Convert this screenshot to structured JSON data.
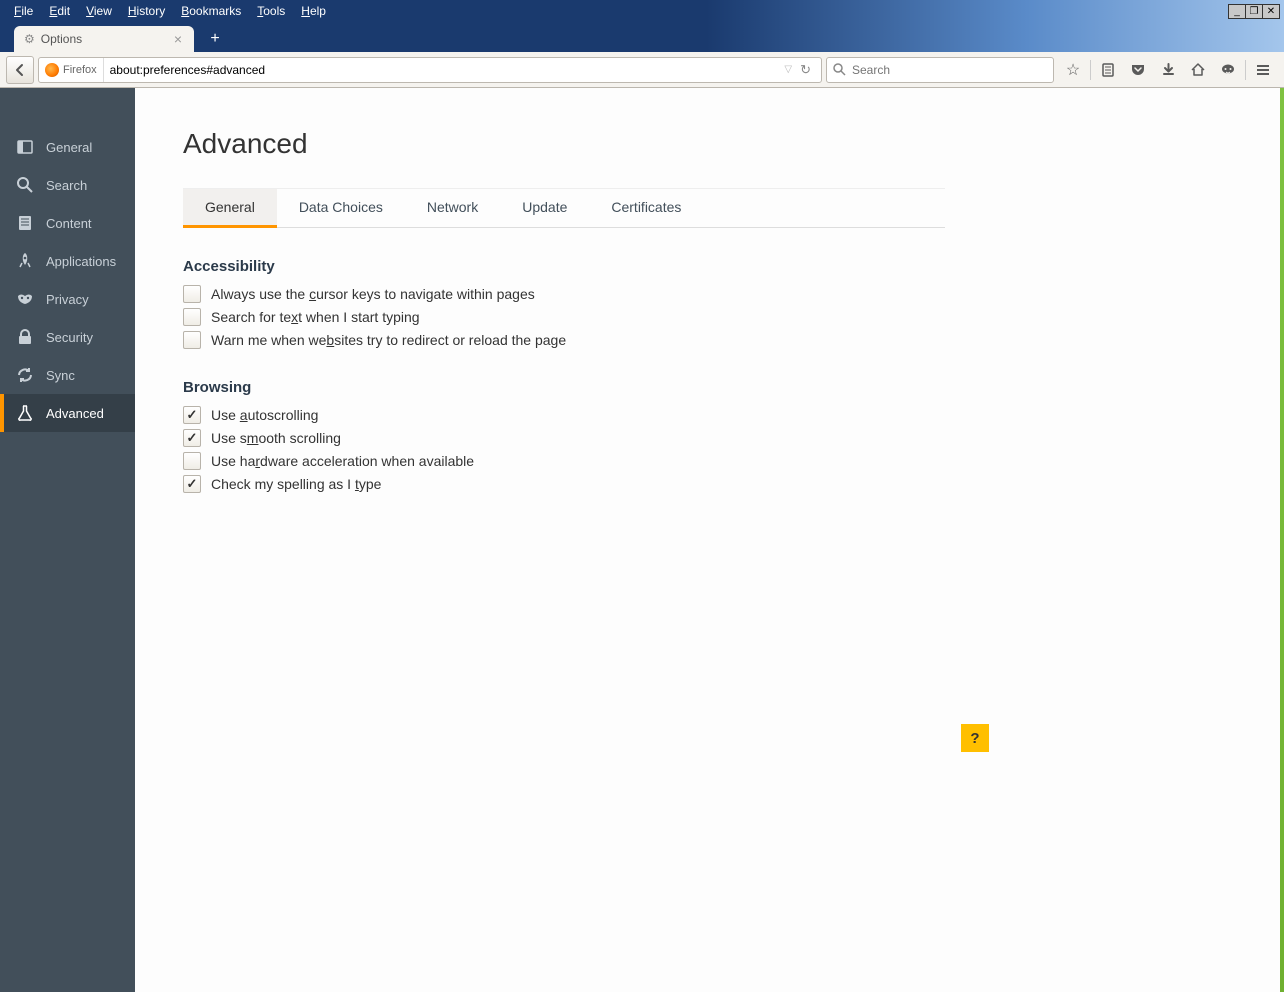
{
  "menubar": [
    "File",
    "Edit",
    "View",
    "History",
    "Bookmarks",
    "Tools",
    "Help"
  ],
  "tab": {
    "title": "Options"
  },
  "identity_label": "Firefox",
  "url": "about:preferences#advanced",
  "search_placeholder": "Search",
  "sidebar": [
    {
      "icon": "panel",
      "label": "General"
    },
    {
      "icon": "search",
      "label": "Search"
    },
    {
      "icon": "doc",
      "label": "Content"
    },
    {
      "icon": "rocket",
      "label": "Applications"
    },
    {
      "icon": "mask",
      "label": "Privacy"
    },
    {
      "icon": "lock",
      "label": "Security"
    },
    {
      "icon": "sync",
      "label": "Sync"
    },
    {
      "icon": "flask",
      "label": "Advanced"
    }
  ],
  "active_sidebar": 7,
  "page_title": "Advanced",
  "subtabs": [
    "General",
    "Data Choices",
    "Network",
    "Update",
    "Certificates"
  ],
  "active_subtab": 0,
  "section_a": {
    "heading": "Accessibility",
    "items": [
      {
        "checked": false,
        "pre": "Always use the ",
        "u": "c",
        "post": "ursor keys to navigate within pages"
      },
      {
        "checked": false,
        "pre": "Search for te",
        "u": "x",
        "post": "t when I start typing"
      },
      {
        "checked": false,
        "pre": "Warn me when we",
        "u": "b",
        "post": "sites try to redirect or reload the page"
      }
    ]
  },
  "section_b": {
    "heading": "Browsing",
    "items": [
      {
        "checked": true,
        "pre": "Use ",
        "u": "a",
        "post": "utoscrolling"
      },
      {
        "checked": true,
        "pre": "Use s",
        "u": "m",
        "post": "ooth scrolling"
      },
      {
        "checked": false,
        "pre": "Use ha",
        "u": "r",
        "post": "dware acceleration when available"
      },
      {
        "checked": true,
        "pre": "Check my spelling as I ",
        "u": "t",
        "post": "ype"
      }
    ]
  },
  "help_glyph": "?"
}
